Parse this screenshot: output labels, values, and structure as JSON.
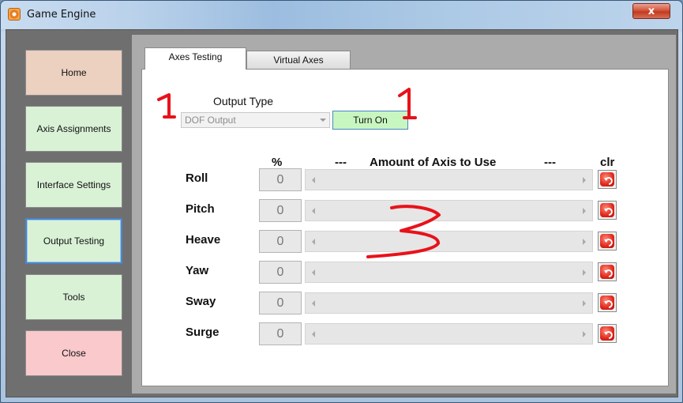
{
  "window": {
    "title": "Game Engine",
    "close_glyph": "x"
  },
  "sidebar": {
    "items": [
      {
        "label": "Home"
      },
      {
        "label": "Axis Assignments"
      },
      {
        "label": "Interface Settings"
      },
      {
        "label": "Output Testing"
      },
      {
        "label": "Tools"
      },
      {
        "label": "Close"
      }
    ]
  },
  "tabs": [
    {
      "label": "Axes Testing"
    },
    {
      "label": "Virtual Axes"
    }
  ],
  "output": {
    "type_label": "Output Type",
    "selected_value": "DOF Output",
    "turn_on_label": "Turn On"
  },
  "headers": {
    "percent": "%",
    "dash_left": "---",
    "amount": "Amount of Axis to Use",
    "dash_right": "---",
    "clr": "clr"
  },
  "axes": [
    {
      "label": "Roll",
      "value": "0"
    },
    {
      "label": "Pitch",
      "value": "0"
    },
    {
      "label": "Heave",
      "value": "0"
    },
    {
      "label": "Yaw",
      "value": "0"
    },
    {
      "label": "Sway",
      "value": "0"
    },
    {
      "label": "Surge",
      "value": "0"
    }
  ],
  "annotations": {
    "mark_1a": "1",
    "mark_1b": "1",
    "mark_3": "3",
    "color": "#e8121a"
  },
  "colors": {
    "active_border": "#4a86c8",
    "turn_on_bg": "#c8f6c0",
    "clear_icon": "#e0261a"
  }
}
